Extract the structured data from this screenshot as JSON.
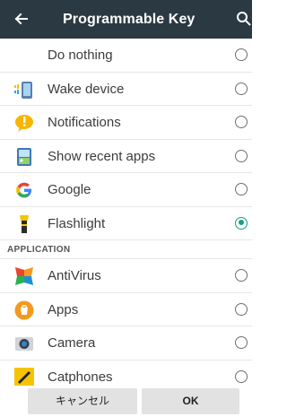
{
  "header": {
    "title": "Programmable Key"
  },
  "rows": [
    {
      "label": "Do nothing",
      "icon": "none",
      "selected": false
    },
    {
      "label": "Wake device",
      "icon": "wake-device-icon",
      "selected": false
    },
    {
      "label": "Notifications",
      "icon": "notifications-icon",
      "selected": false
    },
    {
      "label": "Show recent apps",
      "icon": "recent-apps-icon",
      "selected": false
    },
    {
      "label": "Google",
      "icon": "google-icon",
      "selected": false
    },
    {
      "label": "Flashlight",
      "icon": "flashlight-icon",
      "selected": true
    }
  ],
  "section": {
    "label": "APPLICATION"
  },
  "apps": [
    {
      "label": "AntiVirus",
      "icon": "antivirus-icon",
      "selected": false
    },
    {
      "label": "Apps",
      "icon": "apps-icon",
      "selected": false
    },
    {
      "label": "Camera",
      "icon": "camera-icon",
      "selected": false
    },
    {
      "label": "Catphones",
      "icon": "catphones-icon",
      "selected": false
    }
  ],
  "buttons": {
    "cancel": "キャンセル",
    "ok": "OK"
  },
  "colors": {
    "appbar": "#2b3a42",
    "accent": "#1a9f86"
  }
}
